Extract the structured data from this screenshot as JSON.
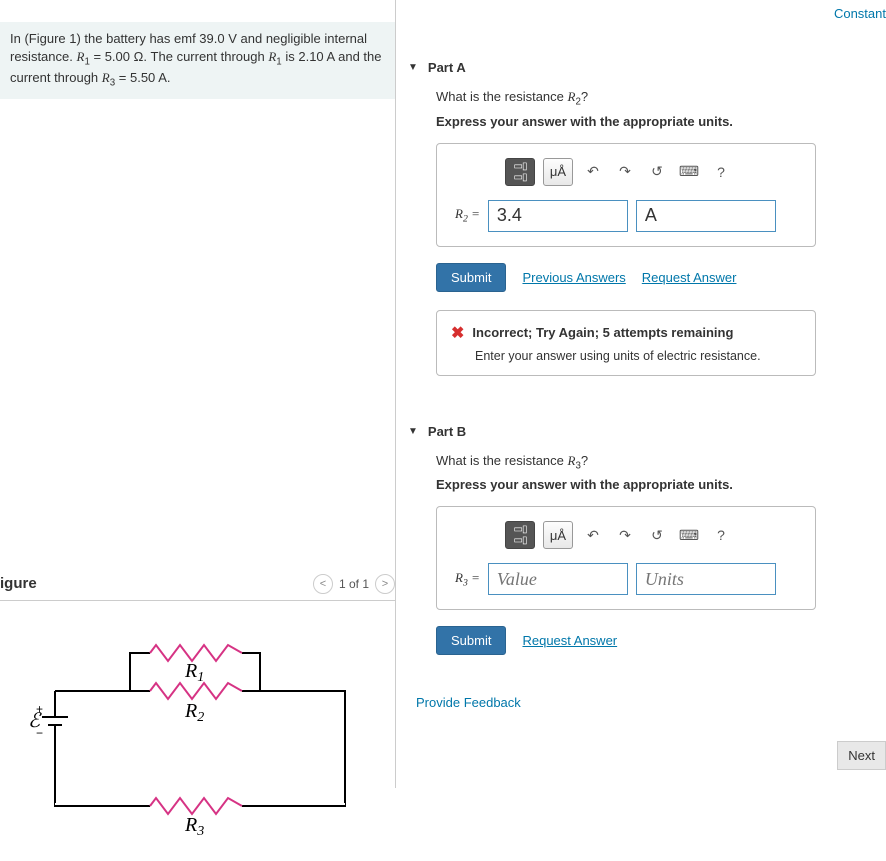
{
  "top_link": "Constant",
  "problem": {
    "text_parts": [
      "In (Figure 1) the battery has emf 39.0 ",
      "V",
      " and negligible internal resistance. ",
      "R",
      "1",
      " = 5.00 ",
      "Ω",
      ". The current through ",
      "R",
      "1",
      " is 2.10 ",
      "A",
      " and the current through ",
      "R",
      "3",
      " = 5.50 ",
      "A",
      "."
    ]
  },
  "figure": {
    "title": "igure",
    "pager": "1 of 1",
    "emf_label": "ℰ",
    "r1": "R",
    "r1sub": "1",
    "r2": "R",
    "r2sub": "2",
    "r3": "R",
    "r3sub": "3",
    "plus": "+",
    "minus": "−"
  },
  "partA": {
    "title": "Part A",
    "question_pre": "What is the resistance ",
    "question_var": "R",
    "question_sub": "2",
    "question_post": "?",
    "instruction": "Express your answer with the appropriate units.",
    "toolbar_mu": "μÅ",
    "label_var": "R",
    "label_sub": "2",
    "label_eq": " = ",
    "value": "3.4",
    "unit": "A",
    "submit": "Submit",
    "prev": "Previous Answers",
    "req": "Request Answer",
    "fb_title": "Incorrect; Try Again; 5 attempts remaining",
    "fb_msg": "Enter your answer using units of electric resistance."
  },
  "partB": {
    "title": "Part B",
    "question_pre": "What is the resistance ",
    "question_var": "R",
    "question_sub": "3",
    "question_post": "?",
    "instruction": "Express your answer with the appropriate units.",
    "toolbar_mu": "μÅ",
    "label_var": "R",
    "label_sub": "3",
    "label_eq": " = ",
    "value_ph": "Value",
    "unit_ph": "Units",
    "submit": "Submit",
    "req": "Request Answer"
  },
  "footer": {
    "provide": "Provide Feedback",
    "next": "Next"
  },
  "icons": {
    "help": "?"
  }
}
